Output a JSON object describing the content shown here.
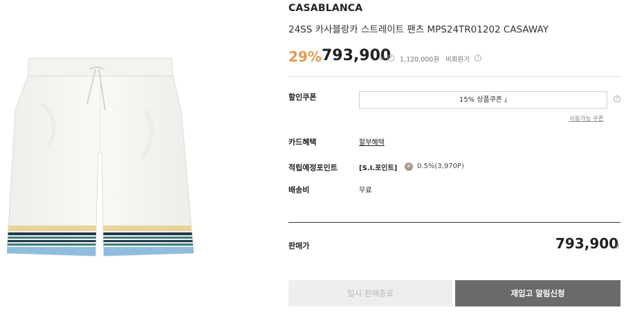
{
  "product": {
    "brand": "CASABLANCA",
    "title": "24SS 카사블랑카 스트레이트 팬츠 MPS24TR01202 CASAWAY",
    "image_alt": "white straight shorts with striped hem"
  },
  "price": {
    "discount": "29%",
    "current": "793,900",
    "currency": "원",
    "help_glyph": "?",
    "original": "1,120,000원",
    "original_label": "비회원가"
  },
  "coupon": {
    "label": "할인쿠폰",
    "button_label": "15% 상품쿠폰",
    "download_glyph": "⤓",
    "available_link": "사용가능 쿠폰"
  },
  "card": {
    "label": "카드혜택",
    "value": "할부혜택"
  },
  "points": {
    "label": "적립예정포인트",
    "tag": "[S.I.포인트]",
    "coin_glyph": "P",
    "rate": "0.5%(3,970P)"
  },
  "shipping": {
    "label": "배송비",
    "value": "무료"
  },
  "sale": {
    "label": "판매가",
    "price": "793,900",
    "currency": "원"
  },
  "buttons": {
    "sold_out": "일시 판매종료",
    "restock": "재입고 알림신청"
  },
  "colors": {
    "discount": "#e39a4f",
    "restock_button": "#6b6b6b",
    "disabled_button": "#eeeeee",
    "stripe_yellow": "#e9d39a",
    "stripe_navy": "#1f3a4a",
    "stripe_teal": "#3e7f7a",
    "stripe_blue": "#8fbde0"
  }
}
